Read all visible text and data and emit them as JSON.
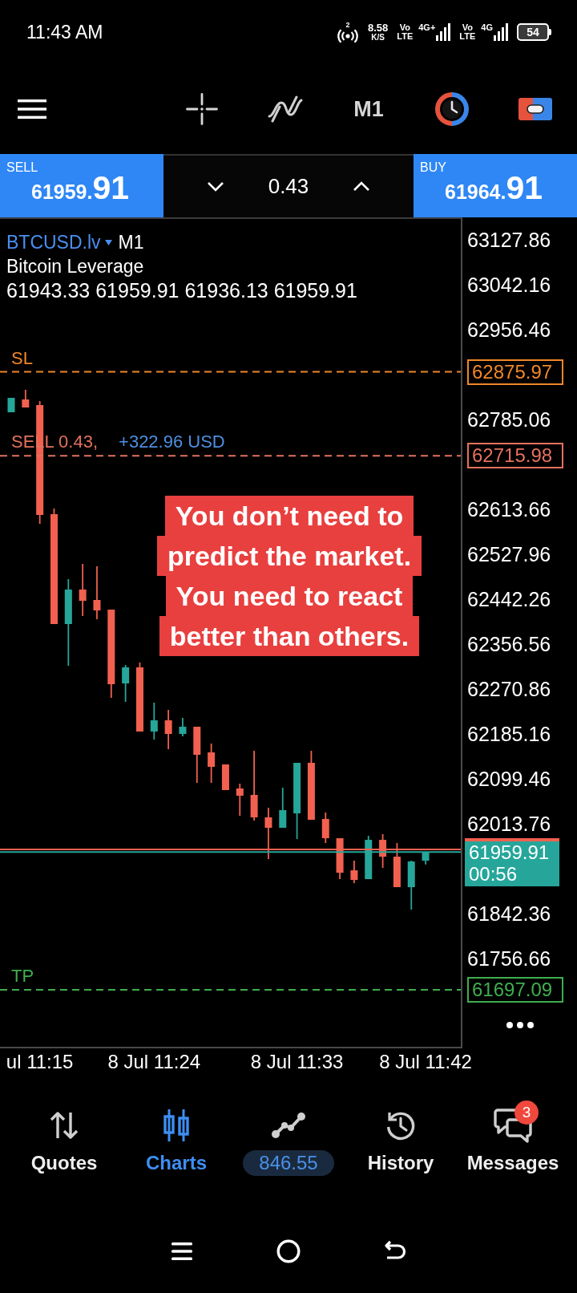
{
  "status_bar": {
    "time": "11:43 AM",
    "hotspot_count": "2",
    "speed": "8.58",
    "speed_unit": "K/S",
    "sims": [
      {
        "volte": "Vo LTE",
        "network": "4G+"
      },
      {
        "volte": "Vo LTE",
        "network": "4G"
      }
    ],
    "battery": "54"
  },
  "toolbar": {
    "timeframe": "M1"
  },
  "trade_bar": {
    "sell": {
      "label": "SELL",
      "price": "61959.",
      "price_tail": "91"
    },
    "volume": "0.43",
    "buy": {
      "label": "BUY",
      "price": "61964.",
      "price_tail": "91"
    }
  },
  "chart": {
    "symbol": "BTCUSD.lv",
    "timeframe": "M1",
    "description": "Bitcoin Leverage",
    "ohlc": "61943.33 61959.91 61936.13 61959.91",
    "chart_data": {
      "type": "candlestick",
      "categories": [
        null,
        null,
        "ul 11:15",
        null,
        null,
        null,
        null,
        null,
        null,
        null,
        "8 Jul 11:24",
        null,
        null,
        null,
        null,
        null,
        null,
        null,
        null,
        null,
        "8 Jul 11:33",
        null,
        null,
        null,
        null,
        null,
        null,
        null,
        null,
        "8 Jul 11:42"
      ],
      "ohlc": [
        [
          62798.83,
          62826.38,
          62798.83,
          62826.38
        ],
        [
          62823.32,
          62841.68,
          62808.01,
          62808.01
        ],
        [
          62812.61,
          62820.26,
          62586.11,
          62602.95
        ],
        [
          62604.48,
          62615.19,
          62394.82,
          62394.82
        ],
        [
          62394.82,
          62480.52,
          62315.24,
          62460.62
        ],
        [
          62460.62,
          62509.59,
          62410.12,
          62439.2
        ],
        [
          62440.73,
          62505.0,
          62404.0,
          62420.83
        ],
        [
          62422.36,
          62422.36,
          62254.02,
          62280.04
        ],
        [
          62281.57,
          62316.77,
          62246.37,
          62312.18
        ],
        [
          62312.18,
          62321.36,
          62189.75,
          62189.75
        ],
        [
          62189.75,
          62244.84,
          62174.45,
          62211.17
        ],
        [
          62211.17,
          62231.07,
          62156.08,
          62185.16
        ],
        [
          62185.16,
          62215.77,
          62180.57,
          62198.93
        ],
        [
          62198.93,
          62198.93,
          62091.81,
          62145.37
        ],
        [
          62149.96,
          62166.79,
          62091.81,
          62122.41
        ],
        [
          62127.0,
          62127.0,
          62078.03,
          62078.03
        ],
        [
          62081.09,
          62090.28,
          62029.06,
          62067.32
        ],
        [
          62068.85,
          62153.02,
          62019.88,
          62026.0
        ],
        [
          62026.0,
          62044.37,
          61946.42,
          62006.11
        ],
        [
          62006.11,
          62082.62,
          62006.11,
          62039.77
        ],
        [
          62033.65,
          62130.07,
          61984.68,
          62130.07
        ],
        [
          62130.07,
          62153.02,
          62021.41,
          62021.41
        ],
        [
          62022.94,
          62035.18,
          61977.03,
          61986.21
        ],
        [
          61986.21,
          61986.21,
          61908.16,
          61920.41
        ],
        [
          61925.0,
          61943.36,
          61900.51,
          61906.63
        ],
        [
          61908.16,
          61990.8,
          61908.16,
          61983.15
        ],
        [
          61983.15,
          61993.86,
          61929.59,
          61951.01
        ],
        [
          61951.01,
          61977.03,
          61892.86,
          61892.86
        ],
        [
          61892.86,
          61943.36,
          61850.01,
          61941.83
        ],
        [
          61943.33,
          61959.91,
          61936.13,
          61959.91
        ]
      ],
      "ylim": [
        61588.36,
        63167.65
      ],
      "yticks": [
        {
          "value": 63127.86,
          "label": "63127.86"
        },
        {
          "value": 63042.16,
          "label": "63042.16"
        },
        {
          "value": 62956.46,
          "label": "62956.46"
        },
        {
          "value": 62875.97,
          "label": "62875.97"
        },
        {
          "value": 62785.06,
          "label": "62785.06"
        },
        {
          "value": 62715.98,
          "label": "62715.98"
        },
        {
          "value": 62613.66,
          "label": "62613.66"
        },
        {
          "value": 62527.96,
          "label": "62527.96"
        },
        {
          "value": 62442.26,
          "label": "62442.26"
        },
        {
          "value": 62356.56,
          "label": "62356.56"
        },
        {
          "value": 62270.86,
          "label": "62270.86"
        },
        {
          "value": 62185.16,
          "label": "62185.16"
        },
        {
          "value": 62099.46,
          "label": "62099.46"
        },
        {
          "value": 62013.76,
          "label": "62013.76"
        },
        {
          "value": 61842.36,
          "label": "61842.36"
        },
        {
          "value": 61756.66,
          "label": "61756.66"
        },
        {
          "value": 61697.09,
          "label": "61697.09"
        }
      ],
      "ref_lines": [
        {
          "axis": "y",
          "value": 62875.97,
          "color": "#f0862a",
          "label": "SL"
        },
        {
          "axis": "y",
          "value": 62715.98,
          "color": "#e4715e",
          "label": "SELL 0.43,"
        },
        {
          "axis": "y",
          "value": 61697.09,
          "color": "#3fae4f",
          "label": "TP"
        },
        {
          "axis": "y",
          "value": 61964.91,
          "color": "#f2604f"
        },
        {
          "axis": "y",
          "value": 61959.91,
          "color": "#26a69a"
        }
      ],
      "annotations": [
        {
          "text": "+322.96 USD",
          "y": 62715.98
        }
      ]
    },
    "bid": {
      "price": "61959.91",
      "countdown": "00:56"
    }
  },
  "caption": [
    "You don’t need to",
    "predict the market.",
    "You need to react",
    "better than others."
  ],
  "bottom_nav": [
    {
      "kind": "tab",
      "label": "Quotes",
      "selected": false
    },
    {
      "kind": "tab",
      "label": "Charts",
      "selected": true
    },
    {
      "kind": "balance",
      "label": "846.55",
      "selected": false
    },
    {
      "kind": "tab",
      "label": "History",
      "selected": false
    },
    {
      "kind": "tab",
      "label": "Messages",
      "selected": false,
      "badge": "3"
    }
  ]
}
